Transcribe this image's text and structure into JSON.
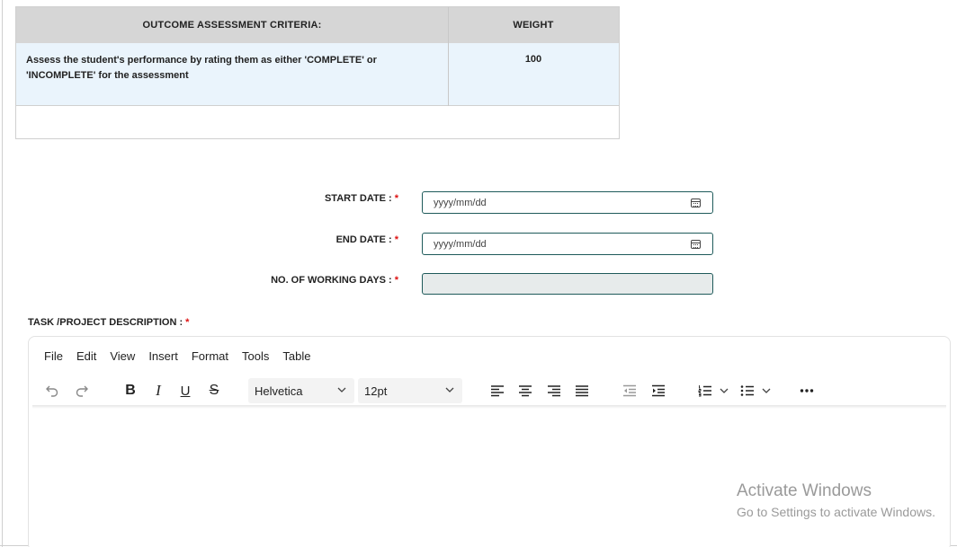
{
  "criteria_table": {
    "headers": {
      "criteria": "OUTCOME ASSESSMENT CRITERIA:",
      "weight": "WEIGHT"
    },
    "rows": [
      {
        "criteria_line1": "Assess the student's performance by rating them as either 'COMPLETE' or",
        "criteria_line2": "'INCOMPLETE' for the assessment",
        "weight": "100"
      }
    ]
  },
  "form": {
    "start_date": {
      "label": "START DATE :",
      "required": "*",
      "placeholder": "yyyy/mm/dd"
    },
    "end_date": {
      "label": "END DATE :",
      "required": "*",
      "placeholder": "yyyy/mm/dd"
    },
    "working_days": {
      "label": "NO. OF WORKING DAYS :",
      "required": "*",
      "value": ""
    },
    "task_description": {
      "label": "TASK /PROJECT DESCRIPTION :",
      "required": "*"
    }
  },
  "editor": {
    "menu": [
      "File",
      "Edit",
      "View",
      "Insert",
      "Format",
      "Tools",
      "Table"
    ],
    "font_family": "Helvetica",
    "font_size": "12pt",
    "format_buttons": {
      "bold": "B",
      "italic": "I",
      "underline": "U",
      "strike": "S"
    },
    "icons": [
      "undo-icon",
      "redo-icon",
      "align-left-icon",
      "align-center-icon",
      "align-right-icon",
      "align-justify-icon",
      "outdent-icon",
      "indent-icon",
      "numbered-list-icon",
      "bullet-list-icon",
      "more-icon"
    ]
  },
  "watermark": {
    "title": "Activate Windows",
    "subtitle": "Go to Settings to activate Windows."
  },
  "colors": {
    "header_bg": "#d6d6d6",
    "row_bg": "#eaf4fc",
    "input_border": "#1e5a5a",
    "required": "#dd1111"
  }
}
